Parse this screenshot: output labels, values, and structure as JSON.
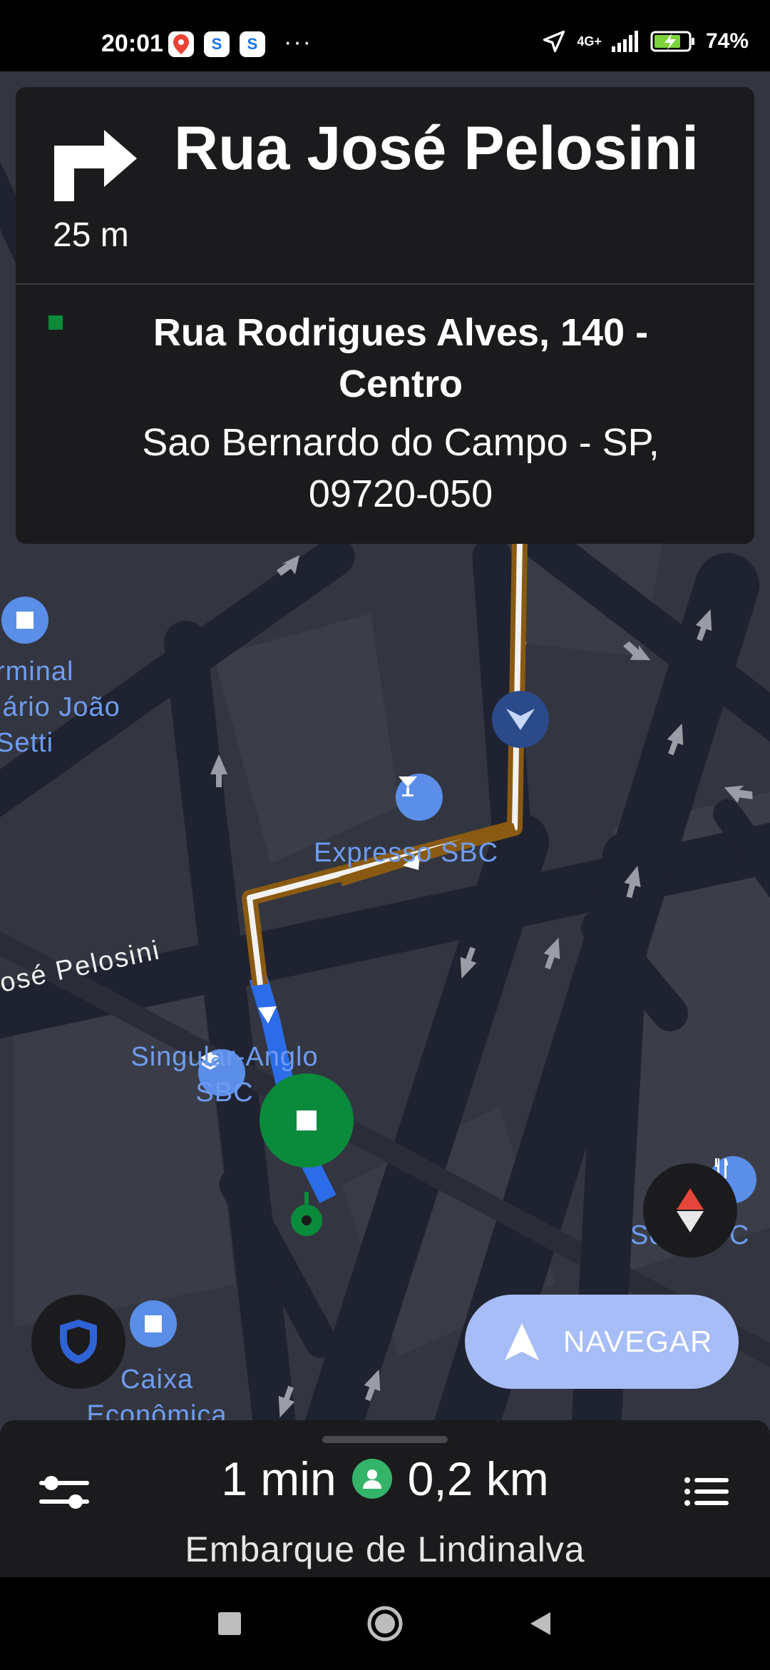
{
  "status_bar": {
    "time": "20:01",
    "app_icons": [
      "maps-pin-icon",
      "app-s-icon",
      "app-s-icon"
    ],
    "overflow": "···",
    "network": "4G+",
    "battery": "74%"
  },
  "navigation": {
    "maneuver": "turn-right",
    "distance": "25 m",
    "street": "Rua José Pelosini"
  },
  "destination": {
    "address": "Rua Rodrigues Alves, 140 - Centro",
    "city": "Sao Bernardo do Campo - SP, 09720-050"
  },
  "map": {
    "street_label": "osé Pelosini",
    "pois": [
      {
        "name": "rminal\niário João\nSetti",
        "icon": "bus-icon"
      },
      {
        "name": "Expresso SBC",
        "icon": "cocktail-icon"
      },
      {
        "name": "Singular-Anglo\nSBC",
        "icon": "school-icon"
      },
      {
        "name": "Caixa\nEconômica",
        "icon": "bank-icon"
      },
      {
        "name": "Se   ão C",
        "icon": "restaurant-icon"
      }
    ],
    "route_color": "#f2f2f2",
    "route_outline": "#8a5a12",
    "pickup_route_color": "#2d6ce8",
    "destination_color": "#0a8a3b"
  },
  "buttons": {
    "navigate": "NAVEGAR"
  },
  "trip": {
    "duration": "1 min",
    "distance": "0,2 km",
    "subtitle": "Embarque de Lindinalva"
  }
}
